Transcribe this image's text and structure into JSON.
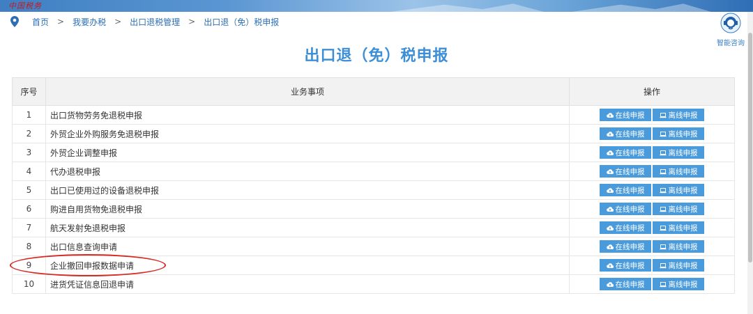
{
  "header": {
    "logo_text": "中国税务"
  },
  "breadcrumb": {
    "items": [
      "首页",
      "我要办税",
      "出口退税管理",
      "出口退（免）税申报"
    ],
    "separator": ">"
  },
  "consult": {
    "label": "智能咨询"
  },
  "page": {
    "title": "出口退（免）税申报"
  },
  "table": {
    "columns": [
      "序号",
      "业务事项",
      "操作"
    ],
    "buttons": {
      "online": "在线申报",
      "offline": "离线申报"
    },
    "rows": [
      {
        "no": "1",
        "name": "出口货物劳务免退税申报"
      },
      {
        "no": "2",
        "name": "外贸企业外购服务免退税申报"
      },
      {
        "no": "3",
        "name": "外贸企业调整申报"
      },
      {
        "no": "4",
        "name": "代办退税申报"
      },
      {
        "no": "5",
        "name": "出口已使用过的设备退税申报"
      },
      {
        "no": "6",
        "name": "购进自用货物免退税申报"
      },
      {
        "no": "7",
        "name": "航天发射免退税申报"
      },
      {
        "no": "8",
        "name": "出口信息查询申请"
      },
      {
        "no": "9",
        "name": "企业撤回申报数据申请"
      },
      {
        "no": "10",
        "name": "进货凭证信息回退申请"
      }
    ]
  },
  "colors": {
    "accent": "#3c8fd6",
    "button": "#4a9bdc",
    "annotation": "#d62a22"
  }
}
